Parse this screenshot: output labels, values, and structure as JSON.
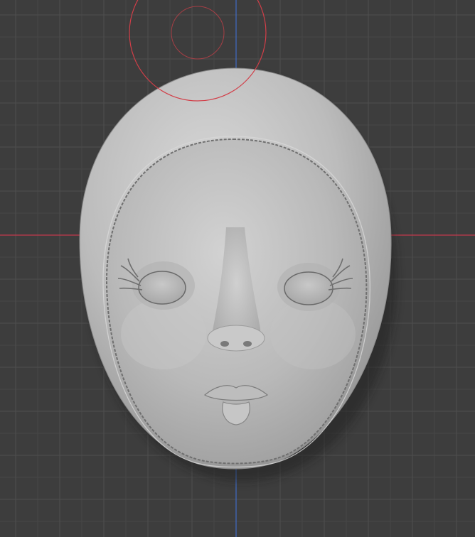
{
  "viewport": {
    "background_color": "#3d3d3d",
    "grid_minor_color": "#464646",
    "grid_major_color": "#4f4f4f",
    "x_axis_color": "#c4394b",
    "y_axis_color": "#3f6cc6"
  },
  "brush_cursor": {
    "color": "#d23e48",
    "icon": "brush-radius-circle"
  },
  "mesh": {
    "base_color": "#bdbdbd",
    "highlight_color": "#d6d6d6",
    "shadow_color": "#777777",
    "icon": "doll-face-sculpt"
  }
}
